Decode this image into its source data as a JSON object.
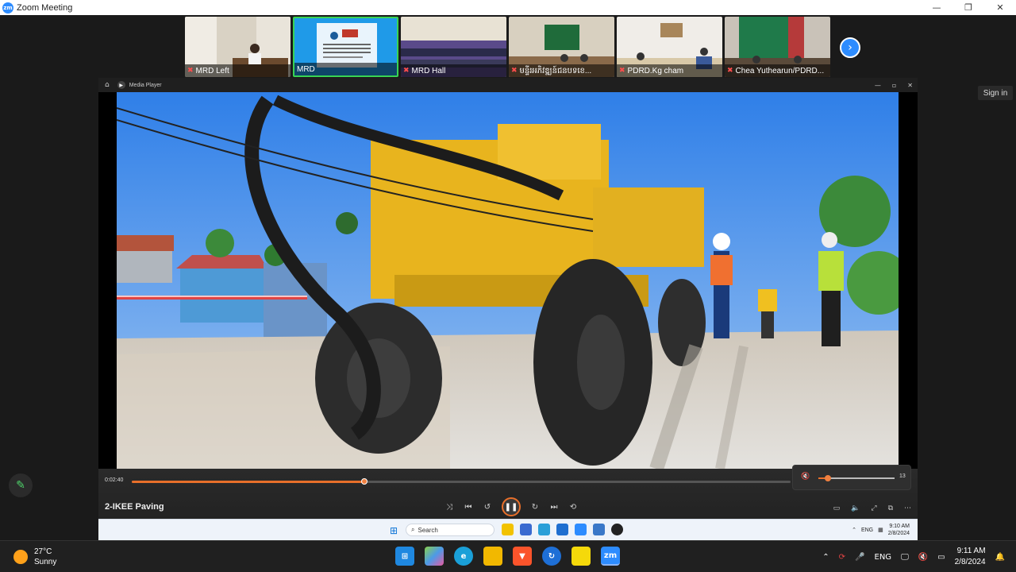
{
  "window": {
    "title": "Zoom Meeting",
    "minimize": "—",
    "maximize": "❐",
    "close": "✕"
  },
  "zoom": {
    "logo": "zm",
    "sign_in": "Sign in",
    "participants": [
      {
        "name": "MRD Left",
        "muted": true
      },
      {
        "name": "MRD",
        "muted": false
      },
      {
        "name": "MRD Hall",
        "muted": true
      },
      {
        "name": "មន្ទីរអភិវឌ្ឍន៍ជនបទខេ...",
        "muted": true
      },
      {
        "name": "PDRD.Kg cham",
        "muted": true
      },
      {
        "name": "Chea Yuthearun/PDRD...",
        "muted": true
      }
    ],
    "next_icon": "next-page-icon",
    "annotate_icon": "pencil-icon"
  },
  "media_player": {
    "app_name": "Media Player",
    "current_time": "0:02:40",
    "video_title": "2-IKEE Paving",
    "progress_fraction": 0.353,
    "volume_value": "13",
    "volume_fraction": 0.13,
    "accent_color": "#e86f2a"
  },
  "remote_taskbar": {
    "search_placeholder": "Search",
    "language": "ENG",
    "time": "9:10 AM",
    "date": "2/8/2024"
  },
  "taskbar": {
    "weather_temp": "27°C",
    "weather_desc": "Sunny",
    "language": "ENG",
    "time": "9:11 AM",
    "date": "2/8/2024"
  }
}
